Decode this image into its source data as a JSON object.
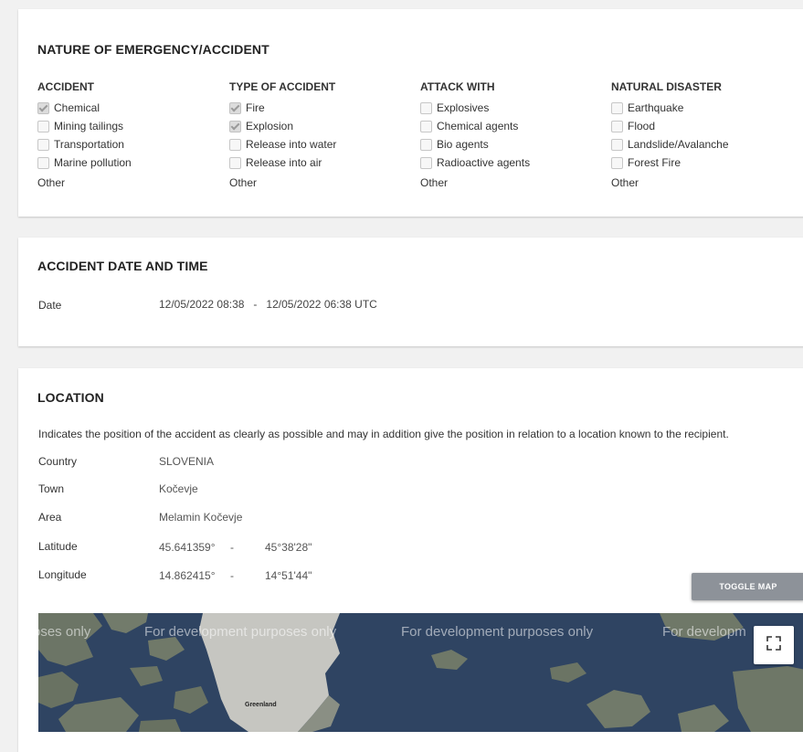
{
  "nature": {
    "title": "NATURE OF EMERGENCY/ACCIDENT",
    "columns": [
      {
        "heading": "ACCIDENT",
        "options": [
          {
            "label": "Chemical",
            "checked": true
          },
          {
            "label": "Mining tailings",
            "checked": false
          },
          {
            "label": "Transportation",
            "checked": false
          },
          {
            "label": "Marine pollution",
            "checked": false
          }
        ],
        "other": "Other"
      },
      {
        "heading": "TYPE OF ACCIDENT",
        "options": [
          {
            "label": "Fire",
            "checked": true
          },
          {
            "label": "Explosion",
            "checked": true
          },
          {
            "label": "Release into water",
            "checked": false
          },
          {
            "label": "Release into air",
            "checked": false
          }
        ],
        "other": "Other"
      },
      {
        "heading": "ATTACK WITH",
        "options": [
          {
            "label": "Explosives",
            "checked": false
          },
          {
            "label": "Chemical agents",
            "checked": false
          },
          {
            "label": "Bio agents",
            "checked": false
          },
          {
            "label": "Radioactive agents",
            "checked": false
          }
        ],
        "other": "Other"
      },
      {
        "heading": "NATURAL DISASTER",
        "options": [
          {
            "label": "Earthquake",
            "checked": false
          },
          {
            "label": "Flood",
            "checked": false
          },
          {
            "label": "Landslide/Avalanche",
            "checked": false
          },
          {
            "label": "Forest Fire",
            "checked": false
          }
        ],
        "other": "Other"
      }
    ]
  },
  "datetime": {
    "title": "ACCIDENT DATE AND TIME",
    "date_label": "Date",
    "date_value": "12/05/2022 08:38   -   12/05/2022 06:38 UTC"
  },
  "location": {
    "title": "LOCATION",
    "description": "Indicates the position of the accident as clearly as possible and may in addition give the position in relation to a location known to the recipient.",
    "country_label": "Country",
    "country": "SLOVENIA",
    "town_label": "Town",
    "town": "Kočevje",
    "area_label": "Area",
    "area": "Melamin Kočevje",
    "latitude_label": "Latitude",
    "latitude_decimal": "45.641359°",
    "latitude_dms": "45°38'28\"",
    "longitude_label": "Longitude",
    "longitude_decimal": "14.862415°",
    "longitude_dms": "14°51'44\"",
    "separator": "-",
    "toggle_map": "TOGGLE MAP"
  },
  "map": {
    "watermark_1": "oses only",
    "watermark_2": "For development purposes only",
    "watermark_3": "For development purposes only",
    "watermark_4": "For developm",
    "place_label": "Greenland",
    "fullscreen_icon": "fullscreen-icon",
    "water_color": "#2f4462",
    "land_color": "#6f7a6a",
    "ice_color": "#c9c9c4"
  }
}
